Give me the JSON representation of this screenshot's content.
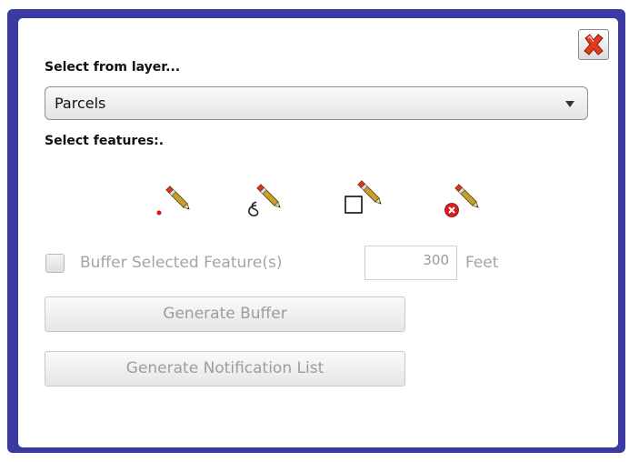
{
  "dialog": {
    "close_icon": "close-icon",
    "select_layer_label": "Select from layer...",
    "layer_select": {
      "value": "Parcels"
    },
    "select_features_label": "Select features:.",
    "tools": [
      {
        "name": "point-select-tool",
        "icon": "pencil-point-icon"
      },
      {
        "name": "line-select-tool",
        "icon": "pencil-freehand-icon"
      },
      {
        "name": "rectangle-select-tool",
        "icon": "pencil-rectangle-icon"
      },
      {
        "name": "clear-selection-tool",
        "icon": "pencil-clear-icon"
      }
    ],
    "buffer_checkbox_label": "Buffer Selected Feature(s)",
    "buffer_distance": "300",
    "buffer_unit": "Feet",
    "generate_buffer_label": "Generate Buffer",
    "generate_notification_label": "Generate Notification List"
  },
  "colors": {
    "frame": "#3b3aa2",
    "close_red": "#e23a1f",
    "disabled_text": "#a4a4a4"
  }
}
